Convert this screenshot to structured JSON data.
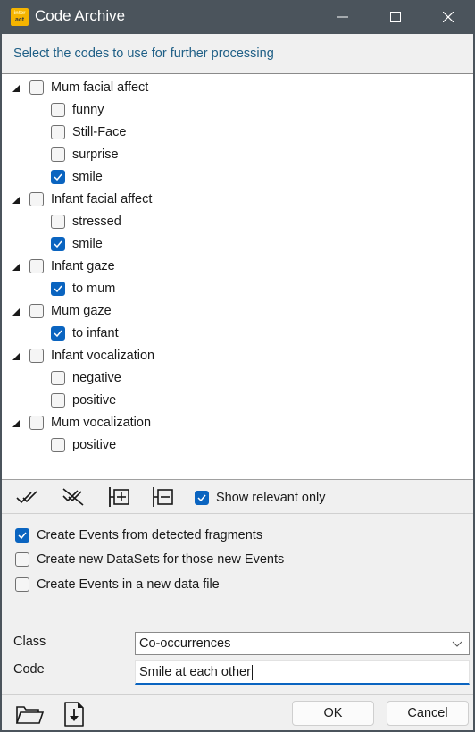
{
  "window": {
    "title": "Code Archive",
    "app_icon_text_top": "inter",
    "app_icon_text_bottom": "act",
    "controls": [
      "minimize",
      "maximize",
      "close"
    ]
  },
  "prompt": "Select the codes to use for further processing",
  "tree": {
    "groups": [
      {
        "label": "Mum facial affect",
        "checked": false,
        "expanded": true,
        "children": [
          {
            "label": "funny",
            "checked": false
          },
          {
            "label": "Still-Face",
            "checked": false
          },
          {
            "label": "surprise",
            "checked": false
          },
          {
            "label": "smile",
            "checked": true
          }
        ]
      },
      {
        "label": "Infant facial affect",
        "checked": false,
        "expanded": true,
        "children": [
          {
            "label": "stressed",
            "checked": false
          },
          {
            "label": "smile",
            "checked": true
          }
        ]
      },
      {
        "label": "Infant gaze",
        "checked": false,
        "expanded": true,
        "children": [
          {
            "label": "to mum",
            "checked": true
          }
        ]
      },
      {
        "label": "Mum gaze",
        "checked": false,
        "expanded": true,
        "children": [
          {
            "label": "to infant",
            "checked": true
          }
        ]
      },
      {
        "label": "Infant vocalization",
        "checked": false,
        "expanded": true,
        "children": [
          {
            "label": "negative",
            "checked": false
          },
          {
            "label": "positive",
            "checked": false
          }
        ]
      },
      {
        "label": "Mum vocalization",
        "checked": false,
        "expanded": true,
        "children": [
          {
            "label": "positive",
            "checked": false
          }
        ]
      }
    ]
  },
  "toolbar": {
    "icons": [
      "check-all-icon",
      "uncheck-all-icon",
      "expand-all-icon",
      "collapse-all-icon"
    ],
    "show_relevant_only": {
      "label": "Show relevant only",
      "checked": true
    }
  },
  "options": [
    {
      "label": "Create Events from detected fragments",
      "checked": true
    },
    {
      "label": "Create new DataSets for those new Events",
      "checked": false
    },
    {
      "label": "Create Events in a new data file",
      "checked": false
    }
  ],
  "form": {
    "class_label": "Class",
    "class_value": "Co-occurrences",
    "code_label": "Code",
    "code_value": "Smile at each other"
  },
  "footer": {
    "ok_label": "OK",
    "cancel_label": "Cancel"
  },
  "colors": {
    "titlebar": "#4b545c",
    "accent": "#0a64c0",
    "prompt_text": "#1f5f86"
  }
}
